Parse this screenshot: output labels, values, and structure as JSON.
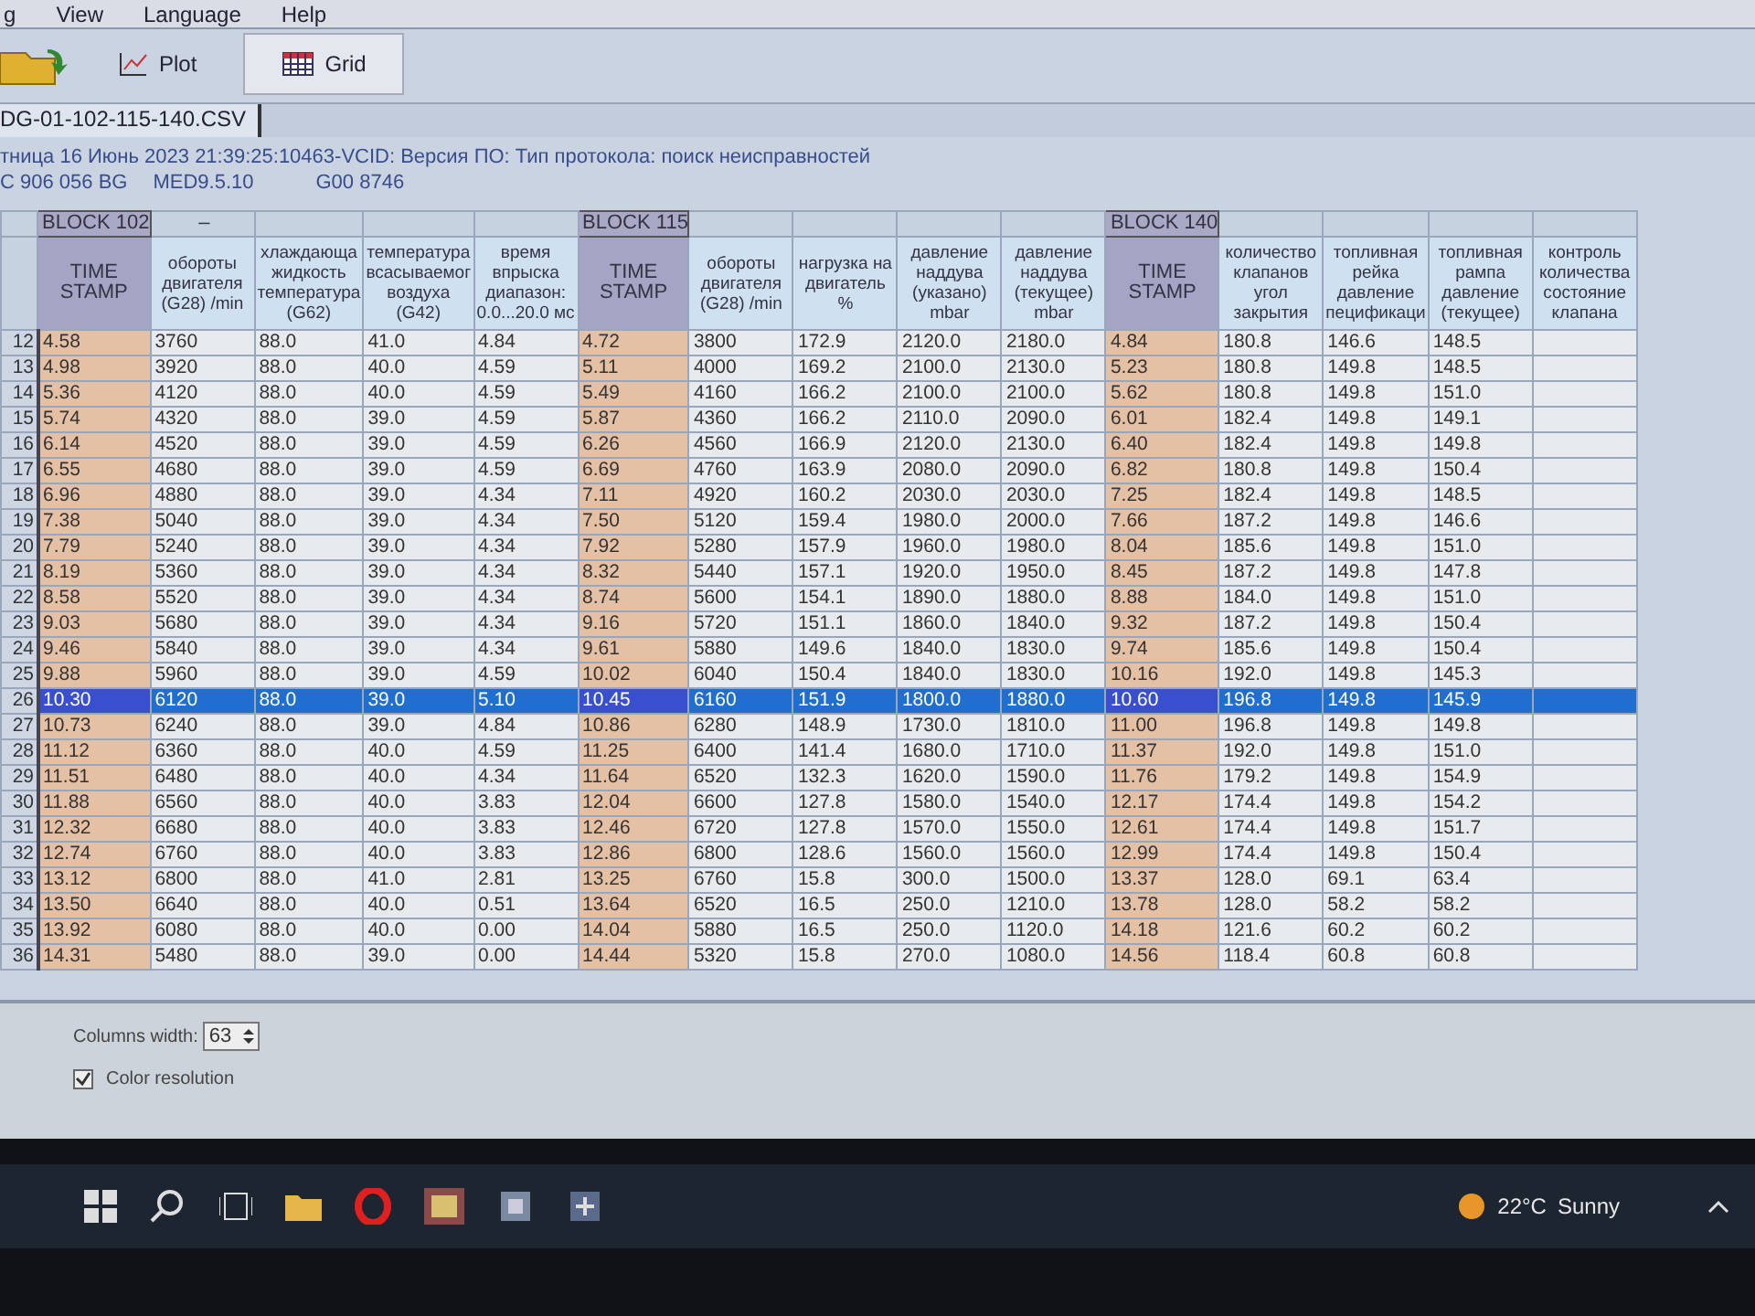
{
  "menu": [
    {
      "label": "g"
    },
    {
      "label": "View"
    },
    {
      "label": "Language"
    },
    {
      "label": "Help"
    }
  ],
  "toolbar": {
    "buttons": [
      {
        "kind": "plot",
        "label": "Plot",
        "selected": false
      },
      {
        "kind": "grid",
        "label": "Grid",
        "selected": true
      }
    ]
  },
  "file_tab": {
    "label": "DG-01-102-115-140.CSV"
  },
  "info": {
    "line_1": "тница 16 Июнь 2023 21:39:25:10463-VCID: Версия ПО: Тип протокола: поиск неисправностей",
    "line_2": [
      "C 906 056 BG",
      "MED9.5.10",
      "G00 8746"
    ]
  },
  "grid": {
    "blocks": [
      {
        "label": "BLOCK 102",
        "mark": "–",
        "columns": [
          {
            "kind": "timestamp",
            "label": "TIME STAMP"
          },
          {
            "kind": "value",
            "label": "обороты двигателя (G28) /min"
          },
          {
            "kind": "value",
            "label": "хлаждающа жидкость температура (G62)"
          },
          {
            "kind": "value",
            "label": "температура всасываемог воздуха (G42)"
          },
          {
            "kind": "value",
            "label": "время впрыска диапазон: 0.0...20.0 мс"
          }
        ]
      },
      {
        "label": "BLOCK 115",
        "columns": [
          {
            "kind": "timestamp",
            "label": "TIME STAMP"
          },
          {
            "kind": "value",
            "label": "обороты двигателя (G28) /min"
          },
          {
            "kind": "value",
            "label": "нагрузка на двигатель %"
          },
          {
            "kind": "value",
            "label": "давление наддува (указано) mbar"
          },
          {
            "kind": "value",
            "label": "давление наддува (текущее) mbar"
          }
        ]
      },
      {
        "label": "BLOCK 140",
        "columns": [
          {
            "kind": "timestamp",
            "label": "TIME STAMP"
          },
          {
            "kind": "value",
            "label": "количество клапанов угол закрытия"
          },
          {
            "kind": "value",
            "label": "топливная рейка давление пецификаци"
          },
          {
            "kind": "value",
            "label": "топливная рампа давление (текущее)"
          },
          {
            "kind": "value",
            "label": "контроль количества состояние клапана"
          }
        ]
      }
    ],
    "rows": [
      {
        "num": "12",
        "selected": false,
        "cells": [
          "4.58",
          "3760",
          "88.0",
          "41.0",
          "4.84",
          "4.72",
          "3800",
          "172.9",
          "2120.0",
          "2180.0",
          "4.84",
          "180.8",
          "146.6",
          "148.5"
        ]
      },
      {
        "num": "13",
        "selected": false,
        "cells": [
          "4.98",
          "3920",
          "88.0",
          "40.0",
          "4.59",
          "5.11",
          "4000",
          "169.2",
          "2100.0",
          "2130.0",
          "5.23",
          "180.8",
          "149.8",
          "148.5"
        ]
      },
      {
        "num": "14",
        "selected": false,
        "cells": [
          "5.36",
          "4120",
          "88.0",
          "40.0",
          "4.59",
          "5.49",
          "4160",
          "166.2",
          "2100.0",
          "2100.0",
          "5.62",
          "180.8",
          "149.8",
          "151.0"
        ]
      },
      {
        "num": "15",
        "selected": false,
        "cells": [
          "5.74",
          "4320",
          "88.0",
          "39.0",
          "4.59",
          "5.87",
          "4360",
          "166.2",
          "2110.0",
          "2090.0",
          "6.01",
          "182.4",
          "149.8",
          "149.1"
        ]
      },
      {
        "num": "16",
        "selected": false,
        "cells": [
          "6.14",
          "4520",
          "88.0",
          "39.0",
          "4.59",
          "6.26",
          "4560",
          "166.9",
          "2120.0",
          "2130.0",
          "6.40",
          "182.4",
          "149.8",
          "149.8"
        ]
      },
      {
        "num": "17",
        "selected": false,
        "cells": [
          "6.55",
          "4680",
          "88.0",
          "39.0",
          "4.59",
          "6.69",
          "4760",
          "163.9",
          "2080.0",
          "2090.0",
          "6.82",
          "180.8",
          "149.8",
          "150.4"
        ]
      },
      {
        "num": "18",
        "selected": false,
        "cells": [
          "6.96",
          "4880",
          "88.0",
          "39.0",
          "4.34",
          "7.11",
          "4920",
          "160.2",
          "2030.0",
          "2030.0",
          "7.25",
          "182.4",
          "149.8",
          "148.5"
        ]
      },
      {
        "num": "19",
        "selected": false,
        "cells": [
          "7.38",
          "5040",
          "88.0",
          "39.0",
          "4.34",
          "7.50",
          "5120",
          "159.4",
          "1980.0",
          "2000.0",
          "7.66",
          "187.2",
          "149.8",
          "146.6"
        ]
      },
      {
        "num": "20",
        "selected": false,
        "cells": [
          "7.79",
          "5240",
          "88.0",
          "39.0",
          "4.34",
          "7.92",
          "5280",
          "157.9",
          "1960.0",
          "1980.0",
          "8.04",
          "185.6",
          "149.8",
          "151.0"
        ]
      },
      {
        "num": "21",
        "selected": false,
        "cells": [
          "8.19",
          "5360",
          "88.0",
          "39.0",
          "4.34",
          "8.32",
          "5440",
          "157.1",
          "1920.0",
          "1950.0",
          "8.45",
          "187.2",
          "149.8",
          "147.8"
        ]
      },
      {
        "num": "22",
        "selected": false,
        "cells": [
          "8.58",
          "5520",
          "88.0",
          "39.0",
          "4.34",
          "8.74",
          "5600",
          "154.1",
          "1890.0",
          "1880.0",
          "8.88",
          "184.0",
          "149.8",
          "151.0"
        ]
      },
      {
        "num": "23",
        "selected": false,
        "cells": [
          "9.03",
          "5680",
          "88.0",
          "39.0",
          "4.34",
          "9.16",
          "5720",
          "151.1",
          "1860.0",
          "1840.0",
          "9.32",
          "187.2",
          "149.8",
          "150.4"
        ]
      },
      {
        "num": "24",
        "selected": false,
        "cells": [
          "9.46",
          "5840",
          "88.0",
          "39.0",
          "4.34",
          "9.61",
          "5880",
          "149.6",
          "1840.0",
          "1830.0",
          "9.74",
          "185.6",
          "149.8",
          "150.4"
        ]
      },
      {
        "num": "25",
        "selected": false,
        "cells": [
          "9.88",
          "5960",
          "88.0",
          "39.0",
          "4.59",
          "10.02",
          "6040",
          "150.4",
          "1840.0",
          "1830.0",
          "10.16",
          "192.0",
          "149.8",
          "145.3"
        ]
      },
      {
        "num": "26",
        "selected": true,
        "cells": [
          "10.30",
          "6120",
          "88.0",
          "39.0",
          "5.10",
          "10.45",
          "6160",
          "151.9",
          "1800.0",
          "1880.0",
          "10.60",
          "196.8",
          "149.8",
          "145.9"
        ]
      },
      {
        "num": "27",
        "selected": false,
        "cells": [
          "10.73",
          "6240",
          "88.0",
          "39.0",
          "4.84",
          "10.86",
          "6280",
          "148.9",
          "1730.0",
          "1810.0",
          "11.00",
          "196.8",
          "149.8",
          "149.8"
        ]
      },
      {
        "num": "28",
        "selected": false,
        "cells": [
          "11.12",
          "6360",
          "88.0",
          "40.0",
          "4.59",
          "11.25",
          "6400",
          "141.4",
          "1680.0",
          "1710.0",
          "11.37",
          "192.0",
          "149.8",
          "151.0"
        ]
      },
      {
        "num": "29",
        "selected": false,
        "cells": [
          "11.51",
          "6480",
          "88.0",
          "40.0",
          "4.34",
          "11.64",
          "6520",
          "132.3",
          "1620.0",
          "1590.0",
          "11.76",
          "179.2",
          "149.8",
          "154.9"
        ]
      },
      {
        "num": "30",
        "selected": false,
        "cells": [
          "11.88",
          "6560",
          "88.0",
          "40.0",
          "3.83",
          "12.04",
          "6600",
          "127.8",
          "1580.0",
          "1540.0",
          "12.17",
          "174.4",
          "149.8",
          "154.2"
        ]
      },
      {
        "num": "31",
        "selected": false,
        "cells": [
          "12.32",
          "6680",
          "88.0",
          "40.0",
          "3.83",
          "12.46",
          "6720",
          "127.8",
          "1570.0",
          "1550.0",
          "12.61",
          "174.4",
          "149.8",
          "151.7"
        ]
      },
      {
        "num": "32",
        "selected": false,
        "cells": [
          "12.74",
          "6760",
          "88.0",
          "40.0",
          "3.83",
          "12.86",
          "6800",
          "128.6",
          "1560.0",
          "1560.0",
          "12.99",
          "174.4",
          "149.8",
          "150.4"
        ]
      },
      {
        "num": "33",
        "selected": false,
        "cells": [
          "13.12",
          "6800",
          "88.0",
          "41.0",
          "2.81",
          "13.25",
          "6760",
          "15.8",
          "300.0",
          "1500.0",
          "13.37",
          "128.0",
          "69.1",
          "63.4"
        ]
      },
      {
        "num": "34",
        "selected": false,
        "cells": [
          "13.50",
          "6640",
          "88.0",
          "40.0",
          "0.51",
          "13.64",
          "6520",
          "16.5",
          "250.0",
          "1210.0",
          "13.78",
          "128.0",
          "58.2",
          "58.2"
        ]
      },
      {
        "num": "35",
        "selected": false,
        "cells": [
          "13.92",
          "6080",
          "88.0",
          "40.0",
          "0.00",
          "14.04",
          "5880",
          "16.5",
          "250.0",
          "1120.0",
          "14.18",
          "121.6",
          "60.2",
          "60.2"
        ]
      },
      {
        "num": "36",
        "selected": false,
        "cells": [
          "14.31",
          "5480",
          "88.0",
          "39.0",
          "0.00",
          "14.44",
          "5320",
          "15.8",
          "270.0",
          "1080.0",
          "14.56",
          "118.4",
          "60.8",
          "60.8"
        ]
      }
    ]
  },
  "settings": {
    "columns_width": {
      "label": "Columns width:",
      "value": "63"
    },
    "color_resolution": {
      "label": "Color resolution",
      "checked": true
    }
  },
  "taskbar": {
    "weather": {
      "temperature": "22°C",
      "condition": "Sunny"
    }
  }
}
